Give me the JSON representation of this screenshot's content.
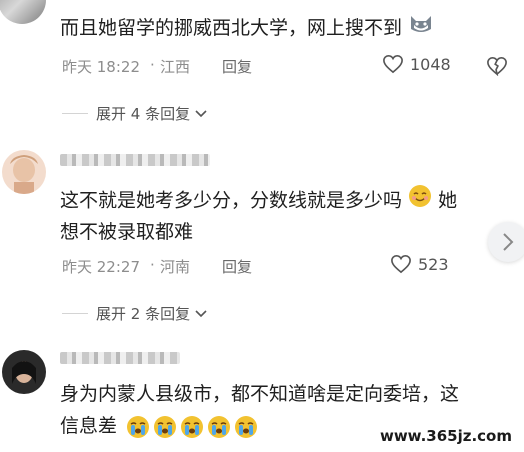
{
  "comments": [
    {
      "text_lines": [
        "而且她留学的挪威西北大学，网上搜不到"
      ],
      "emoji": "cat-face-emoji",
      "time": "昨天 18:22",
      "location": "江西",
      "reply_label": "回复",
      "likes": "1048",
      "expand_label": "展开 4 条回复"
    },
    {
      "text_lines": [
        "这不就是她考多少分，分数线就是多少吗",
        "她",
        "想不被录取都难"
      ],
      "emoji": "smiling-face-emoji",
      "time": "昨天 22:27",
      "location": "河南",
      "reply_label": "回复",
      "likes": "523",
      "expand_label": "展开 2 条回复"
    },
    {
      "text_lines": [
        "身为内蒙人县级市，都不知道啥是定向委培，这",
        "信息差"
      ],
      "emoji": "crying-face-emoji",
      "emoji_count": 5
    }
  ],
  "watermark": "www.365jz.com",
  "colors": {
    "meta": "#8d8d8d",
    "text": "#1f1f1f",
    "emoji": "#f2c230"
  }
}
